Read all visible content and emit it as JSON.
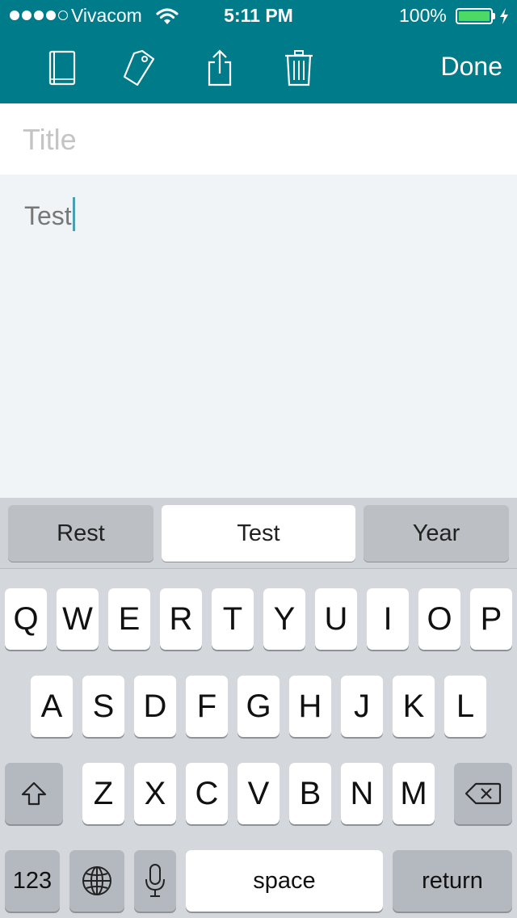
{
  "status_bar": {
    "carrier": "Vivacom",
    "time": "5:11 PM",
    "battery_percent": "100%",
    "signal_bars_filled": 4,
    "signal_bars_total": 5,
    "battery_level": 1.0
  },
  "toolbar": {
    "icons": [
      "notebook-icon",
      "tag-icon",
      "share-icon",
      "trash-icon"
    ],
    "done_label": "Done"
  },
  "note": {
    "title_placeholder": "Title",
    "title_value": "",
    "body_text": "Test"
  },
  "keyboard": {
    "suggestions": [
      "Rest",
      "Test",
      "Year"
    ],
    "row1": [
      "Q",
      "W",
      "E",
      "R",
      "T",
      "Y",
      "U",
      "I",
      "O",
      "P"
    ],
    "row2": [
      "A",
      "S",
      "D",
      "F",
      "G",
      "H",
      "J",
      "K",
      "L"
    ],
    "row3": [
      "Z",
      "X",
      "C",
      "V",
      "B",
      "N",
      "M"
    ],
    "numbers_label": "123",
    "space_label": "space",
    "return_label": "return"
  },
  "colors": {
    "accent": "#007b8a",
    "battery": "#4cd964",
    "caret": "#4a9fb0"
  }
}
